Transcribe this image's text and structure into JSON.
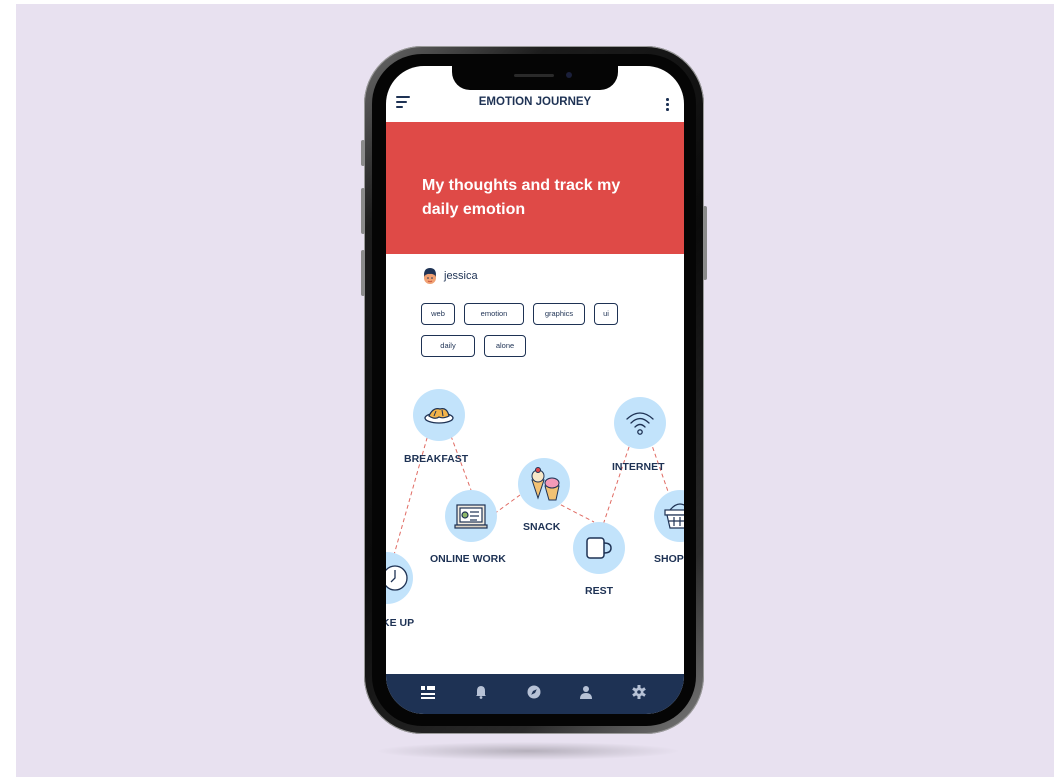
{
  "app": {
    "title": "EMOTION JOURNEY"
  },
  "hero": {
    "text": "My thoughts and track my daily emotion"
  },
  "user": {
    "name": "jessica"
  },
  "tags": [
    "web",
    "emotion",
    "graphics",
    "ui",
    "daily",
    "alone"
  ],
  "journey": {
    "nodes": [
      {
        "label": "BREAKFAST",
        "icon": "breakfast-plate-icon"
      },
      {
        "label": "INTERNET",
        "icon": "wifi-icon"
      },
      {
        "label": "SNACK",
        "icon": "ice-cream-icon"
      },
      {
        "label": "ONLINE WORK",
        "icon": "laptop-icon"
      },
      {
        "label": "REST",
        "icon": "coffee-mug-icon"
      },
      {
        "label": "SHOP",
        "icon": "shopping-basket-icon"
      },
      {
        "label": "KE UP",
        "icon": "clock-icon"
      }
    ]
  },
  "tabbar": {
    "items": [
      "dashboard-icon",
      "bell-icon",
      "compass-icon",
      "profile-icon",
      "settings-icon"
    ],
    "active_index": 0
  },
  "colors": {
    "background": "#e8e1f0",
    "hero": "#df4a47",
    "navy": "#1e3254",
    "node_circle": "#c2e3fb",
    "connector": "#e06b63"
  }
}
